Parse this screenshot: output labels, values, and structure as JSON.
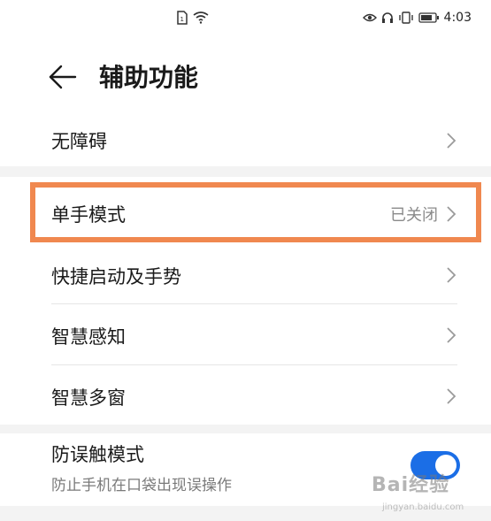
{
  "status_bar": {
    "time": "4:03",
    "left_icons": [
      "sim-icon",
      "wifi-icon"
    ],
    "right_icons": [
      "eye-icon",
      "headphone-icon",
      "vibrate-icon",
      "battery-icon"
    ]
  },
  "header": {
    "title": "辅助功能"
  },
  "items": [
    {
      "label": "无障碍",
      "value": ""
    },
    {
      "label": "单手模式",
      "value": "已关闭"
    },
    {
      "label": "快捷启动及手势",
      "value": ""
    },
    {
      "label": "智慧感知",
      "value": ""
    },
    {
      "label": "智慧多窗",
      "value": ""
    }
  ],
  "toggle_item": {
    "label": "防误触模式",
    "sublabel": "防止手机在口袋出现误操作",
    "enabled": true
  },
  "watermark": {
    "brand": "Bai经验",
    "url": "jingyan.baidu.com"
  },
  "colors": {
    "accent": "#1b6ee6",
    "highlight": "#f0884f"
  }
}
